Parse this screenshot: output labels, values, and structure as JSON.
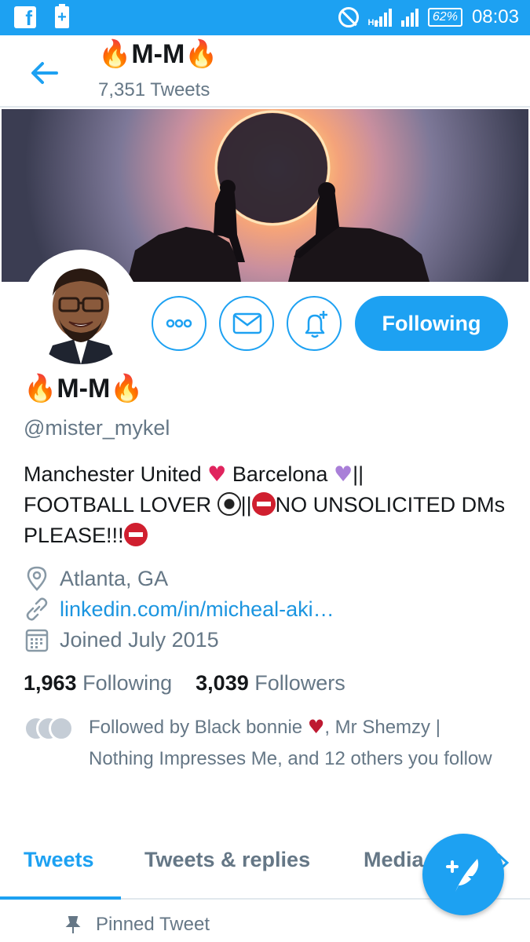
{
  "status_bar": {
    "battery_percent": "62%",
    "time": "08:03",
    "network": "H+"
  },
  "header": {
    "name_text": "M-M",
    "tweets_count": "7,351 Tweets"
  },
  "actions": {
    "following_label": "Following"
  },
  "profile": {
    "name_text": "M-M",
    "handle": "@mister_mykel",
    "bio": {
      "part1": "Manchester United ",
      "part2": " Barcelona ",
      "part3": "||",
      "part4": "FOOTBALL LOVER ",
      "part5": "||",
      "part6": "NO UNSOLICITED DMs PLEASE!!!"
    },
    "location": "Atlanta, GA",
    "website": "linkedin.com/in/micheal-aki…",
    "joined": "Joined July 2015"
  },
  "stats": {
    "following_count": "1,963",
    "following_label": "Following",
    "followers_count": "3,039",
    "followers_label": "Followers"
  },
  "followed_by": {
    "prefix": "Followed by Black bonnie ",
    "suffix": ", Mr Shemzy | Nothing Impresses Me, and 12 others you follow"
  },
  "tabs": [
    {
      "label": "Tweets"
    },
    {
      "label": "Tweets & replies"
    },
    {
      "label": "Media"
    }
  ],
  "pinned_label": "Pinned Tweet",
  "colors": {
    "accent": "#1da1f2",
    "secondary_text": "#657786",
    "primary_text": "#14171a",
    "link": "#1b95e0"
  }
}
